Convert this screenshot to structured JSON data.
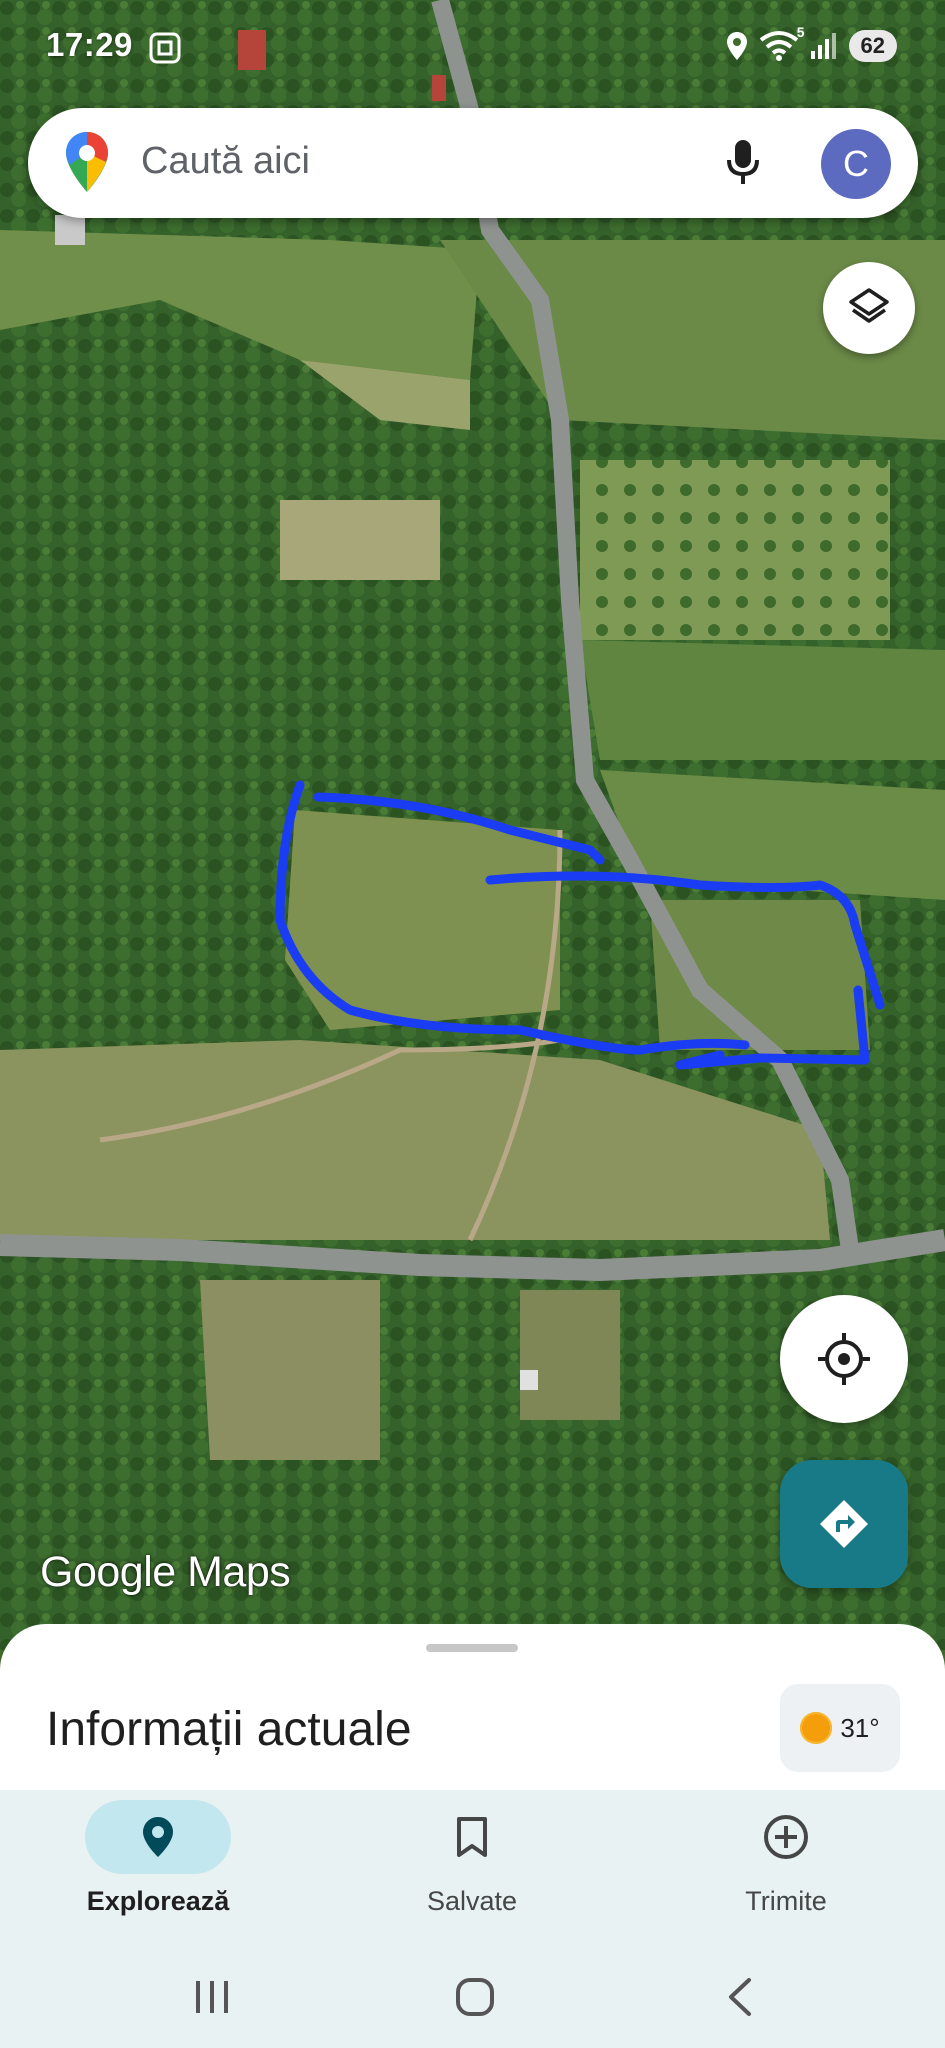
{
  "status_bar": {
    "time": "17:29",
    "battery": "62",
    "wifi_badge": "5"
  },
  "search": {
    "placeholder": "Caută aici",
    "avatar_letter": "C"
  },
  "map": {
    "watermark": "Google Maps",
    "drawn_outline_color": "#1a3cf2"
  },
  "sheet": {
    "title": "Informații actuale",
    "weather_temp": "31°"
  },
  "bottom_nav": {
    "items": [
      {
        "label": "Explorează",
        "icon": "pin-icon",
        "active": true
      },
      {
        "label": "Salvate",
        "icon": "bookmark-icon",
        "active": false
      },
      {
        "label": "Trimite",
        "icon": "add-circle-icon",
        "active": false
      }
    ]
  },
  "system_nav": [
    "recents-icon",
    "home-icon",
    "back-icon"
  ],
  "colors": {
    "accent_teal": "#187a86",
    "nav_active_pill": "#c2e7ef",
    "avatar": "#5c6bc0"
  }
}
